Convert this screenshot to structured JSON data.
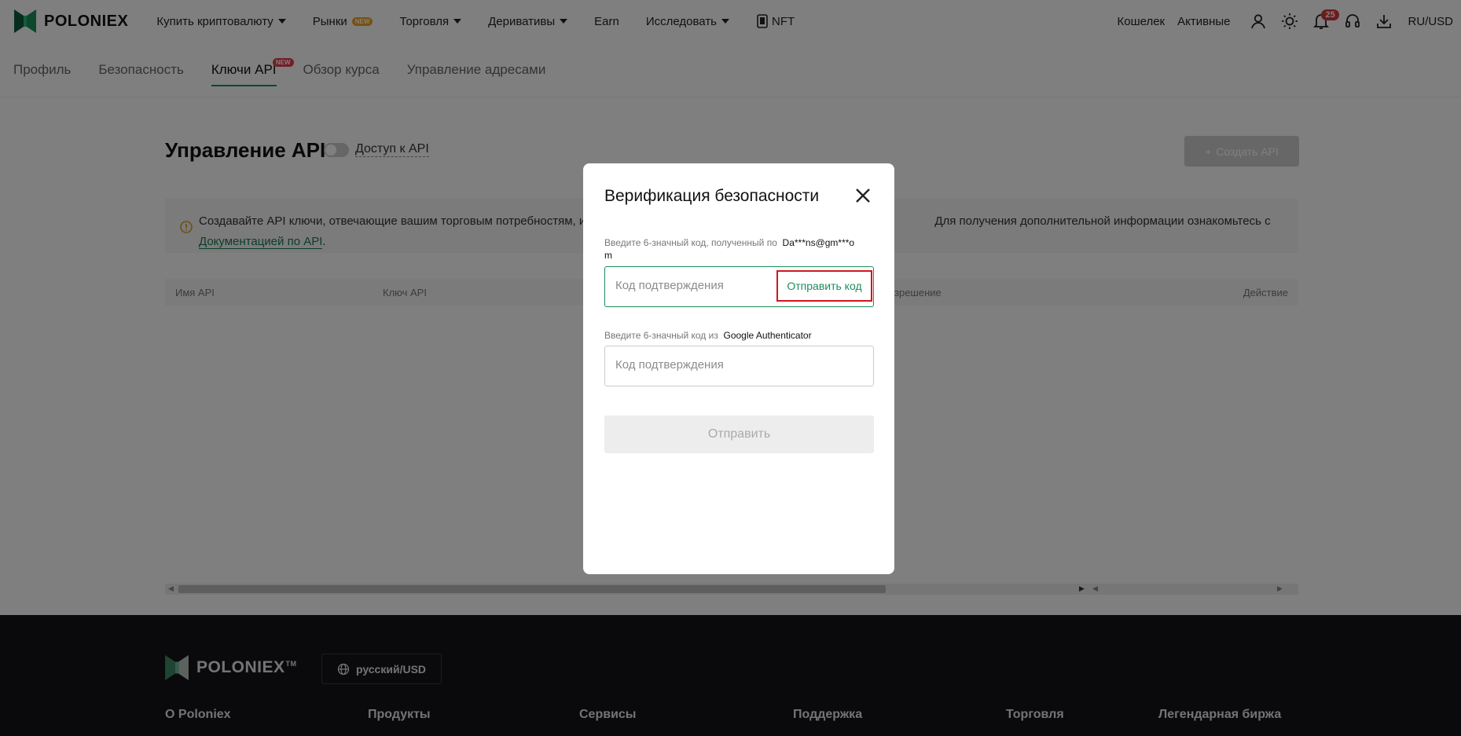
{
  "brand": {
    "name": "POLONIEX",
    "footer_name": "POLONIEX",
    "tm": "TM"
  },
  "nav": {
    "items": [
      {
        "label": "Купить криптовалюту",
        "dropdown": true
      },
      {
        "label": "Рынки",
        "badge": "NEW"
      },
      {
        "label": "Торговля",
        "dropdown": true
      },
      {
        "label": "Деривативы",
        "dropdown": true
      },
      {
        "label": "Earn"
      },
      {
        "label": "Исследовать",
        "dropdown": true
      },
      {
        "label": "NFT"
      }
    ],
    "wallet": "Кошелек",
    "assets": "Активные",
    "notifications": "25",
    "locale": "RU/USD"
  },
  "tabs": [
    {
      "label": "Профиль"
    },
    {
      "label": "Безопасность"
    },
    {
      "label": "Ключи API",
      "badge": "NEW",
      "active": true
    },
    {
      "label": "Обзор курса"
    },
    {
      "label": "Управление адресами"
    }
  ],
  "page": {
    "title": "Управление API",
    "toggle_label": "Доступ к API",
    "create_button": "Создать API",
    "info_text_1": "Создавайте API ключи, отвечающие вашим торговым потребностям, и не",
    "info_text_2": "Для получения дополнительной информации ознакомьтесь с",
    "info_link": "Документацией по API",
    "info_end": "."
  },
  "table": {
    "headers": [
      "Имя API",
      "Ключ API",
      "зрешение",
      "Действие"
    ]
  },
  "footer": {
    "language": "русский/USD",
    "columns": [
      "О Poloniex",
      "Продукты",
      "Сервисы",
      "Поддержка",
      "Торговля",
      "Легендарная биржа"
    ]
  },
  "modal": {
    "title": "Верификация безопасности",
    "email_label_prefix": "Введите 6-значный код, полученный по",
    "email_masked_1": "Da***ns@gm***o",
    "email_masked_2": "m",
    "email_placeholder": "Код подтверждения",
    "send_code": "Отправить код",
    "ga_label_prefix": "Введите 6-значный код из",
    "ga_name": "Google Authenticator",
    "ga_placeholder": "Код подтверждения",
    "submit": "Отправить"
  },
  "colors": {
    "accent": "#1b8e5d",
    "highlight": "#d0171d",
    "badge": "#d9363e"
  }
}
